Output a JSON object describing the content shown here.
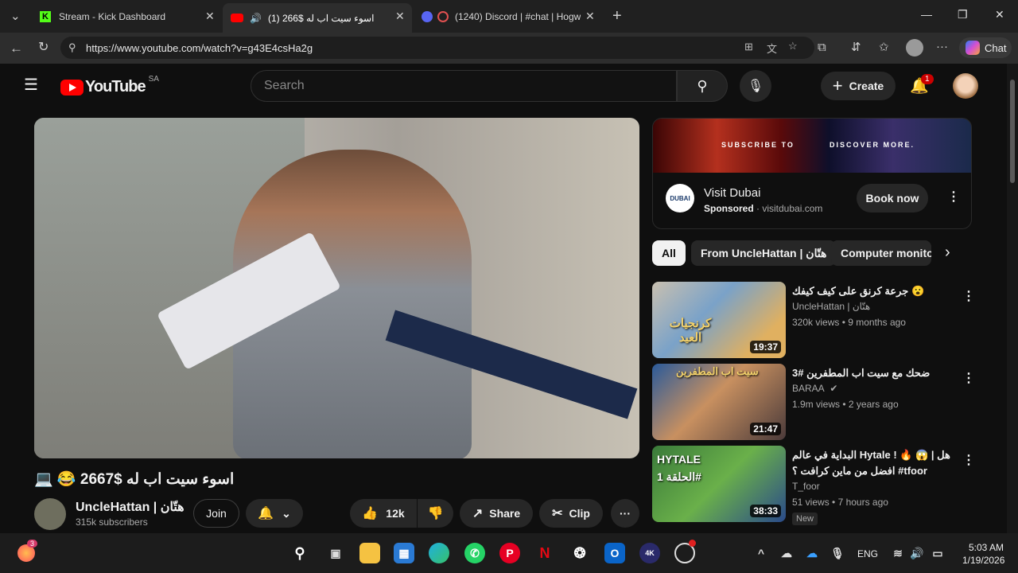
{
  "browser": {
    "tabs": [
      {
        "title": "Stream - Kick Dashboard"
      },
      {
        "title": "(1) اسوء سيت اب له $266"
      },
      {
        "title": "(1240) Discord | #chat | Hogw"
      }
    ],
    "url": "https://www.youtube.com/watch?v=g43E4csHa2g",
    "chat_label": "Chat"
  },
  "youtube": {
    "logo_text": "YouTube",
    "region": "SA",
    "search_placeholder": "Search",
    "create_label": "Create",
    "notification_count": "1"
  },
  "video": {
    "title": "💻 😂 اسوء سيت اب له $2667",
    "channel": "UncleHattan | هتّان",
    "subscribers": "315k subscribers",
    "join_label": "Join",
    "likes": "12k",
    "share_label": "Share",
    "clip_label": "Clip"
  },
  "ad": {
    "banner_left": "SUBSCRIBE TO",
    "banner_right": "DISCOVER MORE.",
    "brand": "Visit Dubai",
    "logo_text": "DUBAI",
    "sponsored": "Sponsored",
    "domain": "visitdubai.com",
    "cta": "Book now"
  },
  "chips": [
    {
      "label": "All"
    },
    {
      "label": "From UncleHattan | هتّان"
    },
    {
      "label": "Computer monito"
    }
  ],
  "recommendations": [
    {
      "title": "جرعة كرنق على كيف كيفك 😮",
      "channel": "UncleHattan | هتّان",
      "views": "320k views",
      "age": "9 months ago",
      "duration": "19:37",
      "thumb_text": "كرنجيات العيد",
      "badge": ""
    },
    {
      "title": "ضحك مع سيت اب المطفرين #3",
      "channel": "BARAA",
      "views": "1.9m views",
      "age": "2 years ago",
      "duration": "21:47",
      "thumb_text": "سيت اب المطفرين",
      "badge": ""
    },
    {
      "title": "البداية في عالم Hytale ! 🔥 😱 | هل افضل من ماين كرافت ؟ #tfoor",
      "channel": "T_foor",
      "views": "51 views",
      "age": "7 hours ago",
      "duration": "38:33",
      "thumb_text": "HYTALE الحلقة 1#",
      "badge": "New"
    }
  ],
  "taskbar": {
    "lang": "ENG",
    "time": "5:03 AM",
    "date": "1/19/2026",
    "firefox_badge": "3"
  },
  "colors": {
    "yt_red": "#ff0000",
    "notif_red": "#cc0000",
    "kick_green": "#53fc18"
  }
}
